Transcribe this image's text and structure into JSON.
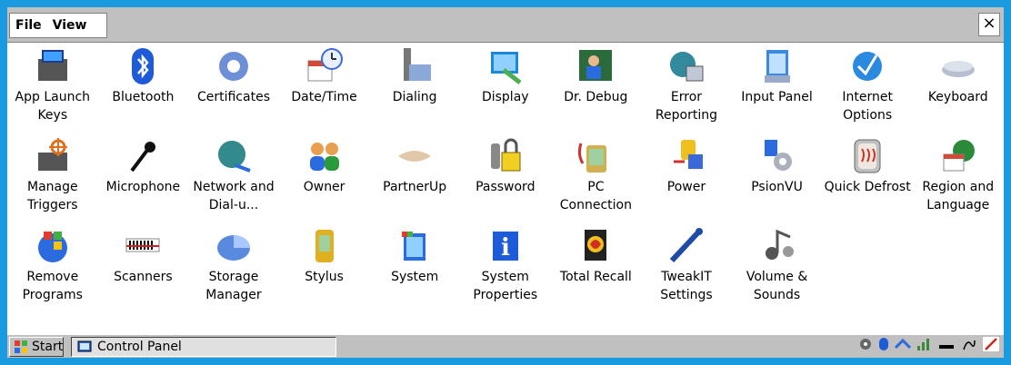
{
  "menu": {
    "file": "File",
    "view": "View",
    "close": "×"
  },
  "items": [
    {
      "label": "App Launch Keys",
      "icon": "app-launch-keys-icon"
    },
    {
      "label": "Bluetooth",
      "icon": "bluetooth-icon"
    },
    {
      "label": "Certificates",
      "icon": "certificates-icon"
    },
    {
      "label": "Date/Time",
      "icon": "date-time-icon"
    },
    {
      "label": "Dialing",
      "icon": "dialing-icon"
    },
    {
      "label": "Display",
      "icon": "display-icon"
    },
    {
      "label": "Dr. Debug",
      "icon": "dr-debug-icon"
    },
    {
      "label": "Error Reporting",
      "icon": "error-reporting-icon"
    },
    {
      "label": "Input Panel",
      "icon": "input-panel-icon"
    },
    {
      "label": "Internet Options",
      "icon": "internet-options-icon"
    },
    {
      "label": "Keyboard",
      "icon": "keyboard-icon"
    },
    {
      "label": "Manage Triggers",
      "icon": "manage-triggers-icon"
    },
    {
      "label": "Microphone",
      "icon": "microphone-icon"
    },
    {
      "label": "Network and Dial-u...",
      "icon": "network-icon"
    },
    {
      "label": "Owner",
      "icon": "owner-icon"
    },
    {
      "label": "PartnerUp",
      "icon": "partnerup-icon"
    },
    {
      "label": "Password",
      "icon": "password-icon"
    },
    {
      "label": "PC Connection",
      "icon": "pc-connection-icon"
    },
    {
      "label": "Power",
      "icon": "power-icon"
    },
    {
      "label": "PsionVU",
      "icon": "psionvu-icon"
    },
    {
      "label": "Quick Defrost",
      "icon": "quick-defrost-icon"
    },
    {
      "label": "Region and Language",
      "icon": "region-language-icon"
    },
    {
      "label": "Remove Programs",
      "icon": "remove-programs-icon"
    },
    {
      "label": "Scanners",
      "icon": "scanners-icon"
    },
    {
      "label": "Storage Manager",
      "icon": "storage-manager-icon"
    },
    {
      "label": "Stylus",
      "icon": "stylus-icon"
    },
    {
      "label": "System",
      "icon": "system-icon"
    },
    {
      "label": "System Properties",
      "icon": "system-properties-icon"
    },
    {
      "label": "Total Recall",
      "icon": "total-recall-icon"
    },
    {
      "label": "TweakIT Settings",
      "icon": "tweakit-icon"
    },
    {
      "label": "Volume & Sounds",
      "icon": "volume-sounds-icon"
    }
  ],
  "taskbar": {
    "start_label": "Start",
    "task_label": "Control Panel",
    "tray_icons": [
      "network-tray-icon",
      "bluetooth-tray-icon",
      "connection-tray-icon",
      "signal-tray-icon",
      "battery-tray-icon",
      "input-tray-icon",
      "pen-tray-icon"
    ]
  },
  "colors": {
    "desktop": "#1a9be0",
    "chrome": "#c0c0c0",
    "content": "#ffffff"
  }
}
